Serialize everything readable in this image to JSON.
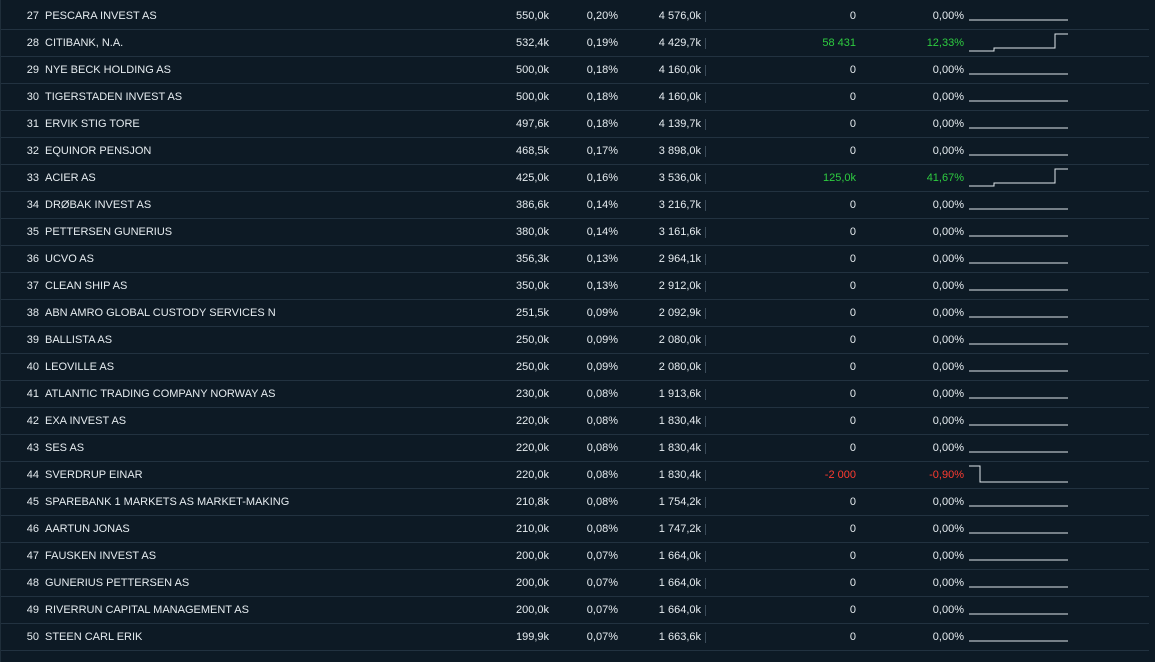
{
  "rows": [
    {
      "rank": "27",
      "name": "PESCARA INVEST AS",
      "shares": "550,0k",
      "pct": "0,20%",
      "value": "4 576,0k",
      "change": "0",
      "change_pct": "0,00%",
      "trend": "flat"
    },
    {
      "rank": "28",
      "name": "CITIBANK, N.A.",
      "shares": "532,4k",
      "pct": "0,19%",
      "value": "4 429,7k",
      "change": "58 431",
      "change_pct": "12,33%",
      "trend": "up"
    },
    {
      "rank": "29",
      "name": "NYE BECK HOLDING AS",
      "shares": "500,0k",
      "pct": "0,18%",
      "value": "4 160,0k",
      "change": "0",
      "change_pct": "0,00%",
      "trend": "flat"
    },
    {
      "rank": "30",
      "name": "TIGERSTADEN INVEST AS",
      "shares": "500,0k",
      "pct": "0,18%",
      "value": "4 160,0k",
      "change": "0",
      "change_pct": "0,00%",
      "trend": "flat"
    },
    {
      "rank": "31",
      "name": "ERVIK STIG TORE",
      "shares": "497,6k",
      "pct": "0,18%",
      "value": "4 139,7k",
      "change": "0",
      "change_pct": "0,00%",
      "trend": "flat"
    },
    {
      "rank": "32",
      "name": "EQUINOR PENSJON",
      "shares": "468,5k",
      "pct": "0,17%",
      "value": "3 898,0k",
      "change": "0",
      "change_pct": "0,00%",
      "trend": "flat"
    },
    {
      "rank": "33",
      "name": "ACIER AS",
      "shares": "425,0k",
      "pct": "0,16%",
      "value": "3 536,0k",
      "change": "125,0k",
      "change_pct": "41,67%",
      "trend": "up"
    },
    {
      "rank": "34",
      "name": "DRØBAK INVEST AS",
      "shares": "386,6k",
      "pct": "0,14%",
      "value": "3 216,7k",
      "change": "0",
      "change_pct": "0,00%",
      "trend": "flat"
    },
    {
      "rank": "35",
      "name": "PETTERSEN GUNERIUS",
      "shares": "380,0k",
      "pct": "0,14%",
      "value": "3 161,6k",
      "change": "0",
      "change_pct": "0,00%",
      "trend": "flat"
    },
    {
      "rank": "36",
      "name": "UCVO AS",
      "shares": "356,3k",
      "pct": "0,13%",
      "value": "2 964,1k",
      "change": "0",
      "change_pct": "0,00%",
      "trend": "flat"
    },
    {
      "rank": "37",
      "name": "CLEAN SHIP AS",
      "shares": "350,0k",
      "pct": "0,13%",
      "value": "2 912,0k",
      "change": "0",
      "change_pct": "0,00%",
      "trend": "flat"
    },
    {
      "rank": "38",
      "name": "ABN AMRO GLOBAL CUSTODY SERVICES N",
      "shares": "251,5k",
      "pct": "0,09%",
      "value": "2 092,9k",
      "change": "0",
      "change_pct": "0,00%",
      "trend": "flat"
    },
    {
      "rank": "39",
      "name": "BALLISTA AS",
      "shares": "250,0k",
      "pct": "0,09%",
      "value": "2 080,0k",
      "change": "0",
      "change_pct": "0,00%",
      "trend": "flat"
    },
    {
      "rank": "40",
      "name": "LEOVILLE AS",
      "shares": "250,0k",
      "pct": "0,09%",
      "value": "2 080,0k",
      "change": "0",
      "change_pct": "0,00%",
      "trend": "flat"
    },
    {
      "rank": "41",
      "name": "ATLANTIC TRADING COMPANY NORWAY AS",
      "shares": "230,0k",
      "pct": "0,08%",
      "value": "1 913,6k",
      "change": "0",
      "change_pct": "0,00%",
      "trend": "flat"
    },
    {
      "rank": "42",
      "name": "EXA INVEST AS",
      "shares": "220,0k",
      "pct": "0,08%",
      "value": "1 830,4k",
      "change": "0",
      "change_pct": "0,00%",
      "trend": "flat"
    },
    {
      "rank": "43",
      "name": "SES AS",
      "shares": "220,0k",
      "pct": "0,08%",
      "value": "1 830,4k",
      "change": "0",
      "change_pct": "0,00%",
      "trend": "flat"
    },
    {
      "rank": "44",
      "name": "SVERDRUP EINAR",
      "shares": "220,0k",
      "pct": "0,08%",
      "value": "1 830,4k",
      "change": "-2 000",
      "change_pct": "-0,90%",
      "trend": "down"
    },
    {
      "rank": "45",
      "name": "SPAREBANK 1 MARKETS AS MARKET-MAKING",
      "shares": "210,8k",
      "pct": "0,08%",
      "value": "1 754,2k",
      "change": "0",
      "change_pct": "0,00%",
      "trend": "flat"
    },
    {
      "rank": "46",
      "name": "AARTUN JONAS",
      "shares": "210,0k",
      "pct": "0,08%",
      "value": "1 747,2k",
      "change": "0",
      "change_pct": "0,00%",
      "trend": "flat"
    },
    {
      "rank": "47",
      "name": "FAUSKEN INVEST AS",
      "shares": "200,0k",
      "pct": "0,07%",
      "value": "1 664,0k",
      "change": "0",
      "change_pct": "0,00%",
      "trend": "flat"
    },
    {
      "rank": "48",
      "name": "GUNERIUS PETTERSEN AS",
      "shares": "200,0k",
      "pct": "0,07%",
      "value": "1 664,0k",
      "change": "0",
      "change_pct": "0,00%",
      "trend": "flat"
    },
    {
      "rank": "49",
      "name": "RIVERRUN CAPITAL MANAGEMENT AS",
      "shares": "200,0k",
      "pct": "0,07%",
      "value": "1 664,0k",
      "change": "0",
      "change_pct": "0,00%",
      "trend": "flat"
    },
    {
      "rank": "50",
      "name": "STEEN CARL ERIK",
      "shares": "199,9k",
      "pct": "0,07%",
      "value": "1 663,6k",
      "change": "0",
      "change_pct": "0,00%",
      "trend": "flat"
    }
  ],
  "colors": {
    "background": "#0d1a25",
    "text": "#e6ecf0",
    "positive": "#2ecc40",
    "negative": "#ff3b30",
    "row_divider": "#223240"
  }
}
